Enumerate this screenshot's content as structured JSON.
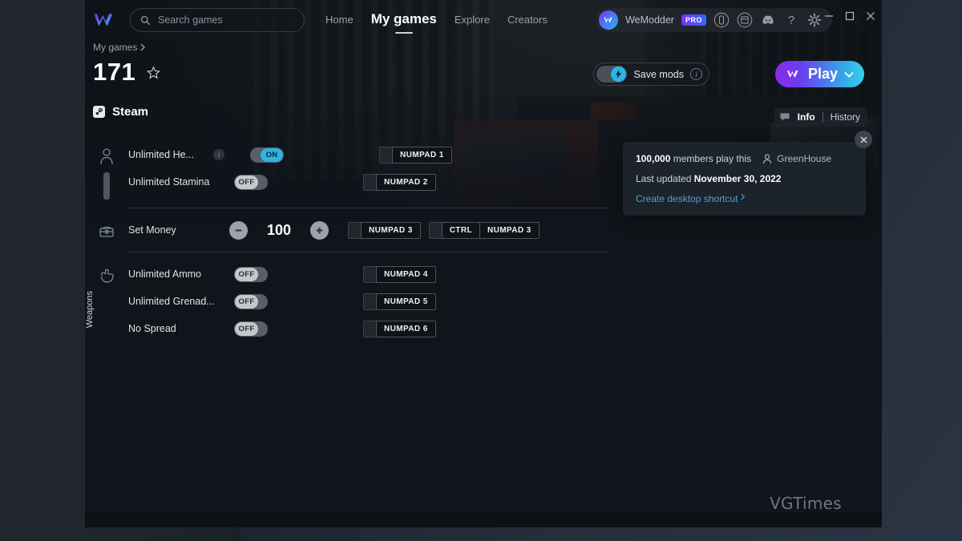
{
  "window": {
    "controls": {
      "minimize": "minimize-icon",
      "maximize": "maximize-icon",
      "close": "close-icon"
    }
  },
  "topbar": {
    "logo": "wemod-logo-icon",
    "search": {
      "placeholder": "Search games",
      "value": "",
      "icon": "search-icon"
    },
    "nav": [
      {
        "label": "Home",
        "active": false
      },
      {
        "label": "My games",
        "active": true
      },
      {
        "label": "Explore",
        "active": false
      },
      {
        "label": "Creators",
        "active": false
      }
    ],
    "user": {
      "name": "WeModder",
      "badge": "PRO",
      "avatar_icon": "wemod-avatar-icon",
      "icons": [
        "phone-icon",
        "window-icon",
        "discord-icon",
        "help-icon",
        "gear-icon"
      ]
    }
  },
  "header": {
    "breadcrumb": {
      "label": "My games",
      "chevron": "chevron-right-icon"
    },
    "game_title": "171",
    "favorite_icon": "star-icon",
    "platform": {
      "label": "Steam",
      "icon": "steam-icon"
    },
    "save_mods": {
      "label": "Save mods",
      "state": "on",
      "info_icon": "info-icon",
      "bolt_icon": "bolt-icon"
    },
    "play": {
      "label": "Play",
      "chevron": "chevron-down-icon",
      "logo": "wemod-logo-icon"
    }
  },
  "tabs": {
    "chat_icon": "chat-icon",
    "items": [
      {
        "label": "Info",
        "active": true
      },
      {
        "label": "History",
        "active": false
      }
    ]
  },
  "info_popover": {
    "members_count": "100,000",
    "members_text": "members play this",
    "author": "GreenHouse",
    "author_icon": "person-icon",
    "updated_prefix": "Last updated",
    "updated_date": "November 30, 2022",
    "shortcut_link": "Create desktop shortcut",
    "shortcut_chevron": "chevron-right-icon",
    "close_icon": "close-icon"
  },
  "mod_groups": [
    {
      "rail_icon": "person-icon",
      "rail_label": "",
      "rail_bar": true,
      "rows": [
        {
          "name": "Unlimited He...",
          "has_info": true,
          "control": "toggle",
          "state": "ON",
          "hotkeys": [
            {
              "keys": [
                "NUMPAD 1"
              ]
            }
          ]
        },
        {
          "name": "Unlimited Stamina",
          "has_info": false,
          "control": "toggle",
          "state": "OFF",
          "hotkeys": [
            {
              "keys": [
                "NUMPAD 2"
              ]
            }
          ]
        }
      ]
    },
    {
      "rail_icon": "chest-icon",
      "rail_label": "",
      "rail_bar": false,
      "rows": [
        {
          "name": "Set Money",
          "has_info": false,
          "control": "stepper",
          "value": "100",
          "minus_icon": "minus-circle-icon",
          "plus_icon": "plus-circle-icon",
          "hotkeys": [
            {
              "keys": [
                "NUMPAD 3"
              ]
            },
            {
              "keys": [
                "CTRL",
                "NUMPAD 3"
              ]
            }
          ]
        }
      ]
    },
    {
      "rail_icon": "hand-pointer-icon",
      "rail_label": "Weapons",
      "rail_bar": false,
      "rows": [
        {
          "name": "Unlimited Ammo",
          "has_info": false,
          "control": "toggle",
          "state": "OFF",
          "hotkeys": [
            {
              "keys": [
                "NUMPAD 4"
              ]
            }
          ]
        },
        {
          "name": "Unlimited Grenad...",
          "has_info": false,
          "control": "toggle",
          "state": "OFF",
          "hotkeys": [
            {
              "keys": [
                "NUMPAD 5"
              ]
            }
          ]
        },
        {
          "name": "No Spread",
          "has_info": false,
          "control": "toggle",
          "state": "OFF",
          "hotkeys": [
            {
              "keys": [
                "NUMPAD 6"
              ]
            }
          ]
        }
      ]
    }
  ],
  "watermark": "VGTimes",
  "colors": {
    "accent_blue": "#2ab4e8",
    "accent_purple": "#8a2be8",
    "link": "#4e9fd8",
    "app_bg": "#11151b",
    "toggle_off": "#c3c8cd"
  }
}
